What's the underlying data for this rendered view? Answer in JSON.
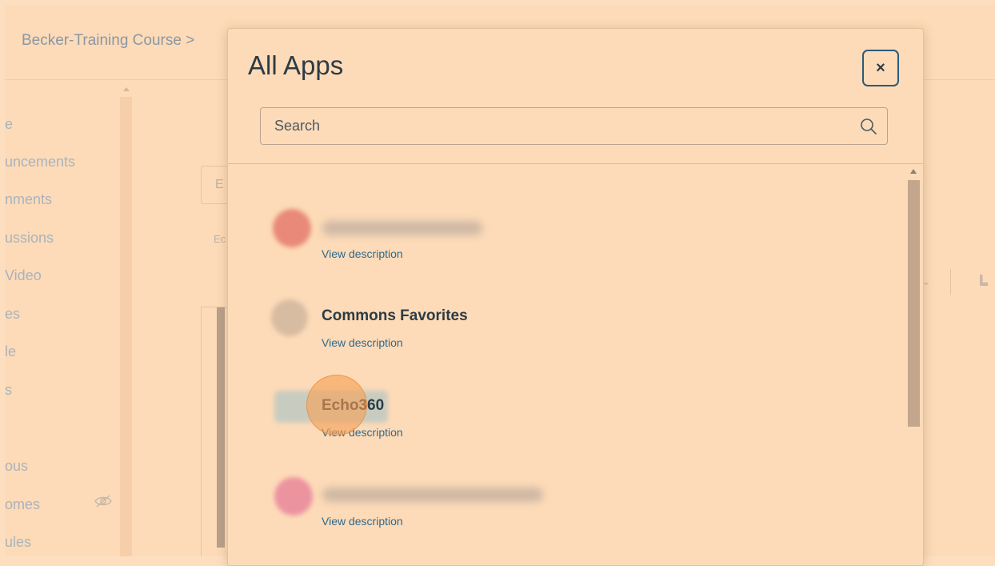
{
  "breadcrumb": {
    "course": "Becker-Training Course",
    "separator": ">"
  },
  "sidebar": {
    "items": [
      {
        "label": "e"
      },
      {
        "label": "uncements"
      },
      {
        "label": "nments"
      },
      {
        "label": "ussions"
      },
      {
        "label": "Video"
      },
      {
        "label": "es"
      },
      {
        "label": "le"
      },
      {
        "label": "s"
      },
      {
        "label": "ous"
      },
      {
        "label": "omes"
      },
      {
        "label": "ules"
      }
    ]
  },
  "background": {
    "input_fragment": "E",
    "small_fragment": "Ec"
  },
  "modal": {
    "title": "All Apps",
    "close_label": "×",
    "search": {
      "placeholder": "Search"
    },
    "apps": [
      {
        "name": "",
        "view_description": "View description",
        "icon_color": "#e8897a"
      },
      {
        "name": "Commons Favorites",
        "view_description": "View description",
        "icon_color": "#d8bca2"
      },
      {
        "name": "Echo360",
        "view_description": "View description",
        "icon_color": "#c8ccc0"
      },
      {
        "name": "",
        "view_description": "View description",
        "icon_color": "#ec93a0"
      }
    ]
  }
}
